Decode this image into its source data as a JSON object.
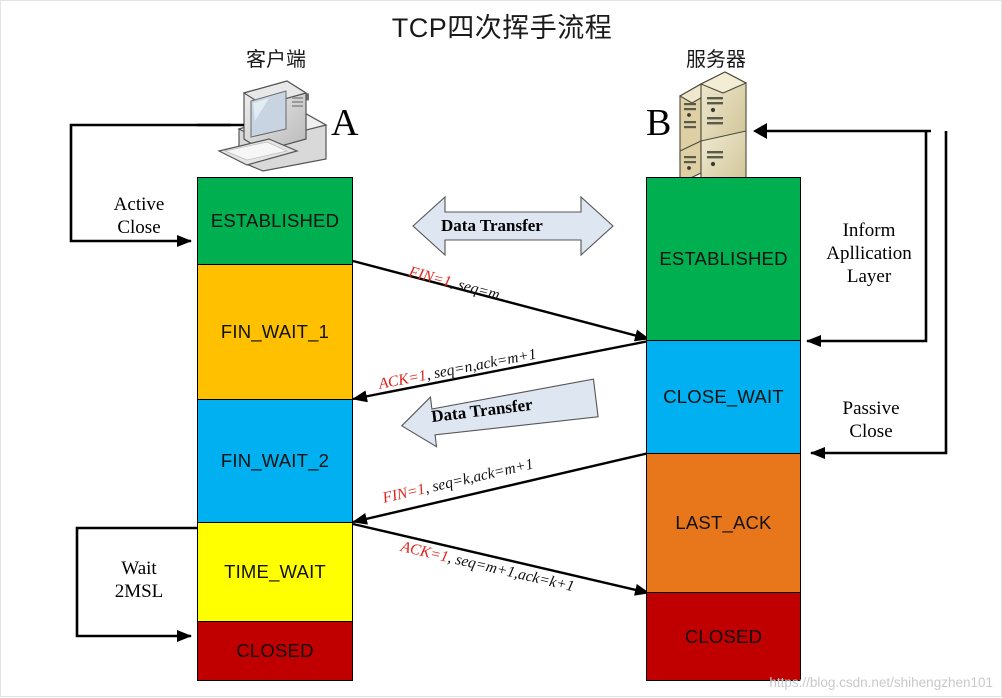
{
  "diagram": {
    "title": "TCP四次挥手流程",
    "watermark": "https://blog.csdn.net/shihengzhen101"
  },
  "endpoints": {
    "client": {
      "caption": "客户端",
      "letter": "A",
      "icon": "desktop-computer-icon"
    },
    "server": {
      "caption": "服务器",
      "letter": "B",
      "icon": "server-rack-icon"
    }
  },
  "client_states": [
    {
      "label": "ESTABLISHED",
      "color": "#00B050",
      "text_color": "#111111"
    },
    {
      "label": "FIN_WAIT_1",
      "color": "#FFC000",
      "text_color": "#111111"
    },
    {
      "label": "FIN_WAIT_2",
      "color": "#00B0F0",
      "text_color": "#111111"
    },
    {
      "label": "TIME_WAIT",
      "color": "#FFFF00",
      "text_color": "#111111"
    },
    {
      "label": "CLOSED",
      "color": "#C00000",
      "text_color": "#111111"
    }
  ],
  "server_states": [
    {
      "label": "ESTABLISHED",
      "color": "#00B050",
      "text_color": "#111111"
    },
    {
      "label": "CLOSE_WAIT",
      "color": "#00B0F0",
      "text_color": "#111111"
    },
    {
      "label": "LAST_ACK",
      "color": "#E8761B",
      "text_color": "#111111"
    },
    {
      "label": "CLOSED",
      "color": "#C00000",
      "text_color": "#111111"
    }
  ],
  "messages": [
    {
      "flag": "FIN=1",
      "rest": ", seq=m",
      "direction": "client-to-server"
    },
    {
      "flag": "ACK=1",
      "rest": ", seq=n,ack=m+1",
      "direction": "server-to-client"
    },
    {
      "flag": "FIN=1",
      "rest": ", seq=k,ack=m+1",
      "direction": "server-to-client"
    },
    {
      "flag": "ACK=1",
      "rest": ", seq=m+1,ack=k+1",
      "direction": "client-to-server"
    }
  ],
  "banners": [
    {
      "label": "Data Transfer",
      "shape": "double-headed-arrow"
    },
    {
      "label": "Data Transfer",
      "shape": "left-arrow"
    }
  ],
  "annotations": {
    "active_close": {
      "line1": "Active",
      "line2": "Close"
    },
    "wait_2msl": {
      "line1": "Wait",
      "line2": "2MSL"
    },
    "inform_app": {
      "line1": "Inform",
      "line2": "Apllication",
      "line3": "Layer"
    },
    "passive_close": {
      "line1": "Passive",
      "line2": "Close"
    }
  },
  "colors": {
    "green": "#00B050",
    "orange": "#FFC000",
    "cyan": "#00B0F0",
    "yellow": "#FFFF00",
    "red": "#C00000",
    "dark_orange": "#E8761B",
    "flag_red": "#E2231A",
    "banner_fill": "#DEE6F2",
    "stroke": "#000000"
  }
}
